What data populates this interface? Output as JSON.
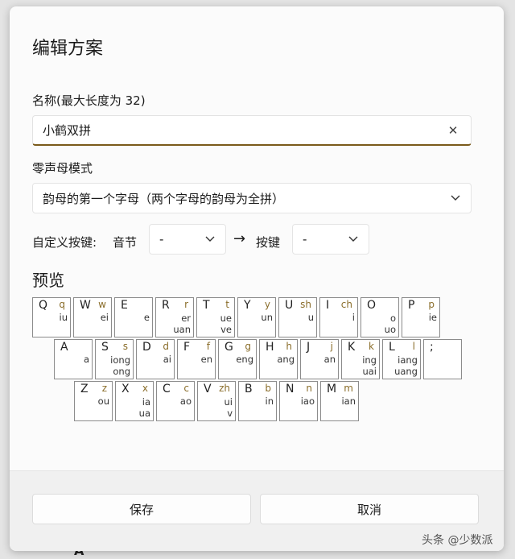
{
  "dialog": {
    "title": "编辑方案",
    "name_label": "名称(最大长度为 32)",
    "name_value": "小鹤双拼",
    "zero_label": "零声母模式",
    "zero_value": "韵母的第一个字母（两个字母的韵母为全拼）",
    "custom_label": "自定义按键:",
    "syllable_label": "音节",
    "syllable_value": "-",
    "key_label": "按键",
    "key_value": "-",
    "preview_label": "预览"
  },
  "keyboard": {
    "rows": [
      [
        {
          "letter": "Q",
          "sm": "q",
          "finals": [
            "iu"
          ]
        },
        {
          "letter": "W",
          "sm": "w",
          "finals": [
            "ei"
          ]
        },
        {
          "letter": "E",
          "sm": "",
          "finals": [
            "e"
          ]
        },
        {
          "letter": "R",
          "sm": "r",
          "finals": [
            "er",
            "uan"
          ]
        },
        {
          "letter": "T",
          "sm": "t",
          "finals": [
            "ue",
            "ve"
          ]
        },
        {
          "letter": "Y",
          "sm": "y",
          "finals": [
            "un"
          ]
        },
        {
          "letter": "U",
          "sm": "sh",
          "finals": [
            "u"
          ]
        },
        {
          "letter": "I",
          "sm": "ch",
          "finals": [
            "i"
          ]
        },
        {
          "letter": "O",
          "sm": "",
          "finals": [
            "o",
            "uo"
          ]
        },
        {
          "letter": "P",
          "sm": "p",
          "finals": [
            "ie"
          ]
        }
      ],
      [
        {
          "letter": "A",
          "sm": "",
          "finals": [
            "a"
          ]
        },
        {
          "letter": "S",
          "sm": "s",
          "finals": [
            "iong",
            "ong"
          ]
        },
        {
          "letter": "D",
          "sm": "d",
          "finals": [
            "ai"
          ]
        },
        {
          "letter": "F",
          "sm": "f",
          "finals": [
            "en"
          ]
        },
        {
          "letter": "G",
          "sm": "g",
          "finals": [
            "eng"
          ]
        },
        {
          "letter": "H",
          "sm": "h",
          "finals": [
            "ang"
          ]
        },
        {
          "letter": "J",
          "sm": "j",
          "finals": [
            "an"
          ]
        },
        {
          "letter": "K",
          "sm": "k",
          "finals": [
            "ing",
            "uai"
          ]
        },
        {
          "letter": "L",
          "sm": "l",
          "finals": [
            "iang",
            "uang"
          ]
        },
        {
          "letter": ";",
          "sm": "",
          "finals": []
        }
      ],
      [
        {
          "letter": "Z",
          "sm": "z",
          "finals": [
            "ou"
          ]
        },
        {
          "letter": "X",
          "sm": "x",
          "finals": [
            "ia",
            "ua"
          ]
        },
        {
          "letter": "C",
          "sm": "c",
          "finals": [
            "ao"
          ]
        },
        {
          "letter": "V",
          "sm": "zh",
          "finals": [
            "ui",
            "v"
          ]
        },
        {
          "letter": "B",
          "sm": "b",
          "finals": [
            "in"
          ]
        },
        {
          "letter": "N",
          "sm": "n",
          "finals": [
            "iao"
          ]
        },
        {
          "letter": "M",
          "sm": "m",
          "finals": [
            "ian"
          ]
        }
      ]
    ]
  },
  "footer": {
    "save": "保存",
    "cancel": "取消"
  },
  "watermark": "头条 @少数派",
  "bg_letter": "A",
  "icons": {
    "clear": "close-icon",
    "dropdown": "chevron-down-icon",
    "arrow": "arrow-right-icon"
  },
  "colors": {
    "accent_underline": "#7a5a1a",
    "shengmu": "#8a6d2a"
  }
}
